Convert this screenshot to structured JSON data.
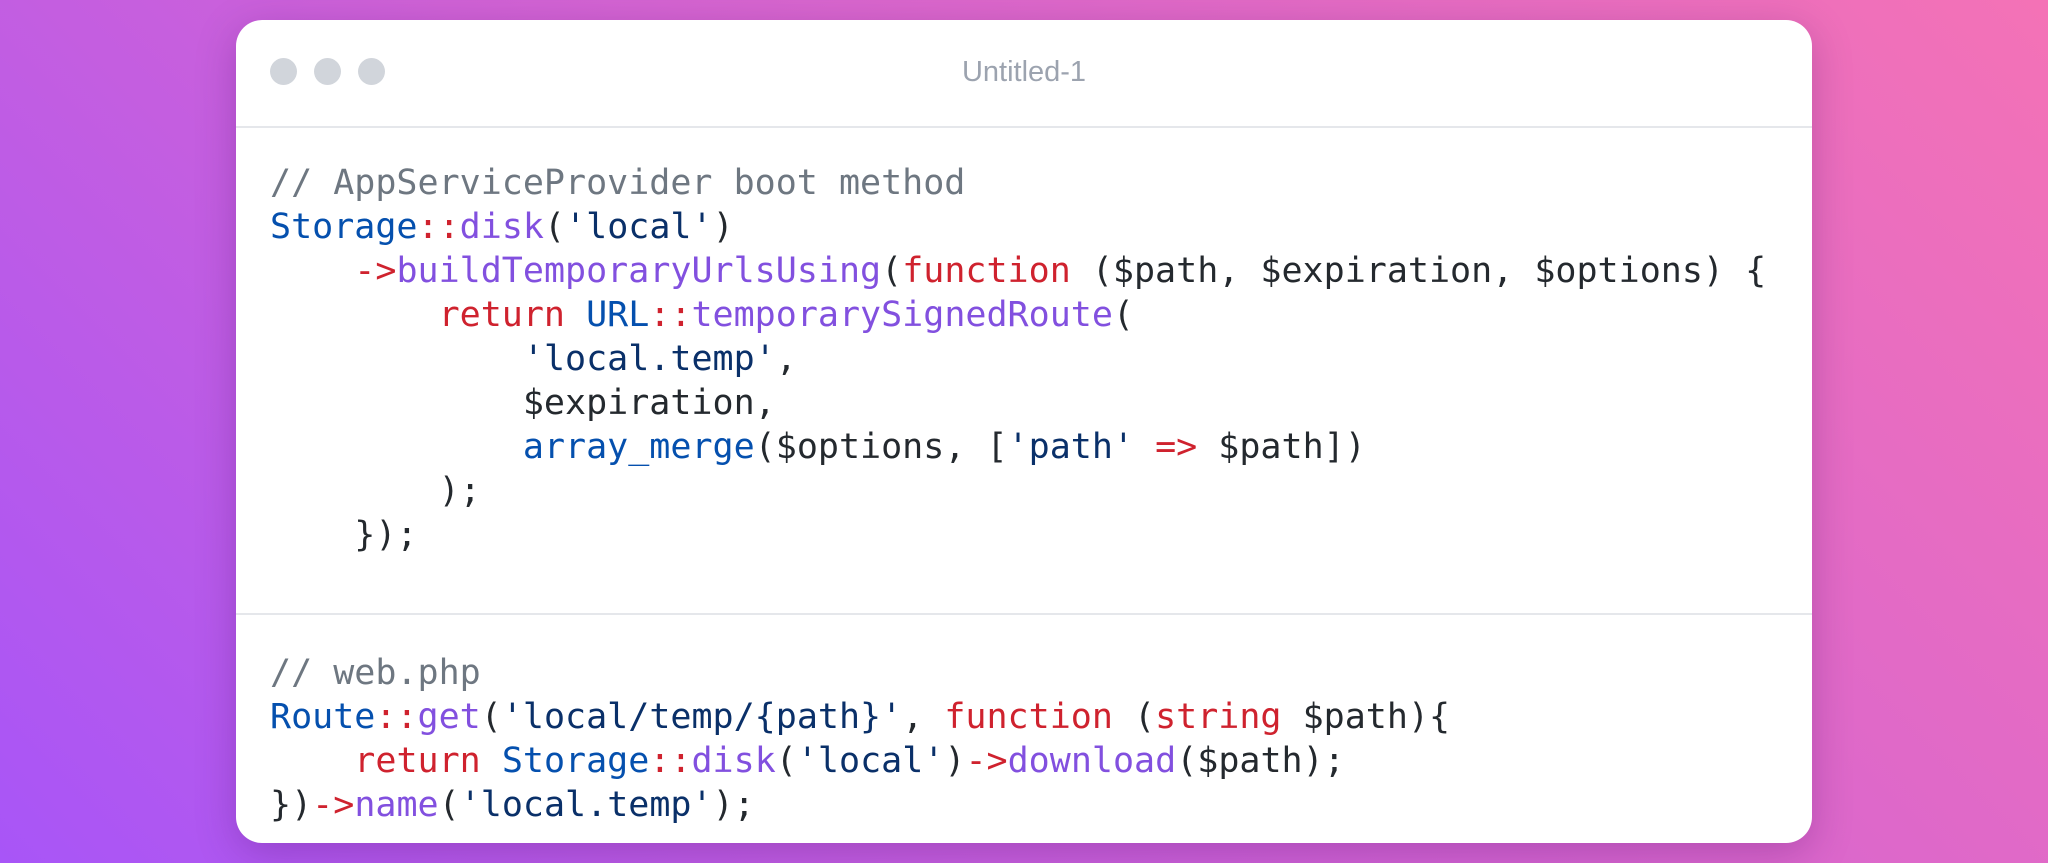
{
  "window": {
    "title": "Untitled-1"
  },
  "colors": {
    "comment": "#6e7781",
    "class": "#0550ae",
    "operator": "#cf222e",
    "method": "#8250df",
    "keyword": "#cf222e",
    "string": "#0a3069",
    "plain": "#24292e"
  },
  "code_blocks": [
    {
      "lines": [
        [
          {
            "t": "cm",
            "v": "// AppServiceProvider boot method"
          }
        ],
        [
          {
            "t": "cls",
            "v": "Storage"
          },
          {
            "t": "op",
            "v": "::"
          },
          {
            "t": "fn",
            "v": "disk"
          },
          {
            "t": "",
            "v": "("
          },
          {
            "t": "str",
            "v": "'local'"
          },
          {
            "t": "",
            "v": ")"
          }
        ],
        [
          {
            "t": "",
            "v": "    "
          },
          {
            "t": "op",
            "v": "->"
          },
          {
            "t": "fn",
            "v": "buildTemporaryUrlsUsing"
          },
          {
            "t": "",
            "v": "("
          },
          {
            "t": "kw",
            "v": "function"
          },
          {
            "t": "",
            "v": " ($path, $expiration, $options) {"
          }
        ],
        [
          {
            "t": "",
            "v": "        "
          },
          {
            "t": "kw",
            "v": "return"
          },
          {
            "t": "",
            "v": " "
          },
          {
            "t": "cls",
            "v": "URL"
          },
          {
            "t": "op",
            "v": "::"
          },
          {
            "t": "fn",
            "v": "temporarySignedRoute"
          },
          {
            "t": "",
            "v": "("
          }
        ],
        [
          {
            "t": "",
            "v": "            "
          },
          {
            "t": "str",
            "v": "'local.temp'"
          },
          {
            "t": "",
            "v": ","
          }
        ],
        [
          {
            "t": "",
            "v": "            $expiration,"
          }
        ],
        [
          {
            "t": "",
            "v": "            "
          },
          {
            "t": "cls",
            "v": "array_merge"
          },
          {
            "t": "",
            "v": "($options, ["
          },
          {
            "t": "str",
            "v": "'path'"
          },
          {
            "t": "",
            "v": " "
          },
          {
            "t": "op",
            "v": "=>"
          },
          {
            "t": "",
            "v": " $path])"
          }
        ],
        [
          {
            "t": "",
            "v": "        );"
          }
        ],
        [
          {
            "t": "",
            "v": "    });"
          }
        ]
      ]
    },
    {
      "lines": [
        [
          {
            "t": "cm",
            "v": "// web.php"
          }
        ],
        [
          {
            "t": "cls",
            "v": "Route"
          },
          {
            "t": "op",
            "v": "::"
          },
          {
            "t": "fn",
            "v": "get"
          },
          {
            "t": "",
            "v": "("
          },
          {
            "t": "str",
            "v": "'local/temp/{path}'"
          },
          {
            "t": "",
            "v": ", "
          },
          {
            "t": "kw",
            "v": "function"
          },
          {
            "t": "",
            "v": " ("
          },
          {
            "t": "kw",
            "v": "string"
          },
          {
            "t": "",
            "v": " $path){"
          }
        ],
        [
          {
            "t": "",
            "v": "    "
          },
          {
            "t": "kw",
            "v": "return"
          },
          {
            "t": "",
            "v": " "
          },
          {
            "t": "cls",
            "v": "Storage"
          },
          {
            "t": "op",
            "v": "::"
          },
          {
            "t": "fn",
            "v": "disk"
          },
          {
            "t": "",
            "v": "("
          },
          {
            "t": "str",
            "v": "'local'"
          },
          {
            "t": "",
            "v": ")"
          },
          {
            "t": "op",
            "v": "->"
          },
          {
            "t": "fn",
            "v": "download"
          },
          {
            "t": "",
            "v": "($path);"
          }
        ],
        [
          {
            "t": "",
            "v": "})"
          },
          {
            "t": "op",
            "v": "->"
          },
          {
            "t": "fn",
            "v": "name"
          },
          {
            "t": "",
            "v": "("
          },
          {
            "t": "str",
            "v": "'local.temp'"
          },
          {
            "t": "",
            "v": ");"
          }
        ]
      ]
    }
  ]
}
